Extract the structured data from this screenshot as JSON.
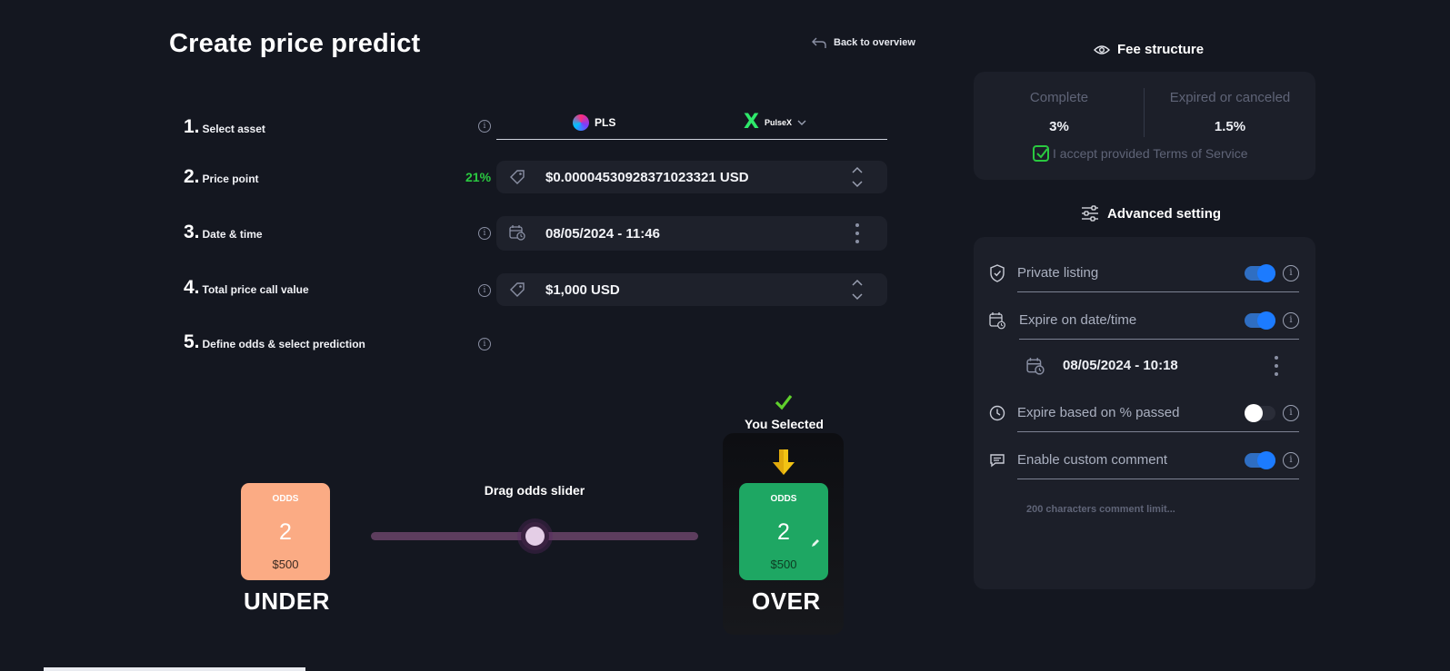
{
  "header": {
    "title": "Create price predict",
    "back_label": "Back to overview"
  },
  "steps": [
    {
      "num": "1.",
      "label": "Select asset"
    },
    {
      "num": "2.",
      "label": "Price point"
    },
    {
      "num": "3.",
      "label": "Date & time"
    },
    {
      "num": "4.",
      "label": "Total price call value"
    },
    {
      "num": "5.",
      "label": "Define odds & select prediction"
    }
  ],
  "asset": {
    "token": "PLS",
    "exchange": "PulseX"
  },
  "price_point": {
    "percent": "21%",
    "value": "$0.0000453092837102332​1 USD"
  },
  "date_time": {
    "value": "08/05/2024 - 11:46"
  },
  "total_value": {
    "value": "$1,000 USD"
  },
  "odds": {
    "slider_label": "Drag odds slider",
    "slider_position": 0.48,
    "you_selected": "You Selected",
    "under": {
      "label": "ODDS",
      "value": "2",
      "amount": "$500",
      "name": "UNDER"
    },
    "over": {
      "label": "ODDS",
      "value": "2",
      "amount": "$500",
      "name": "OVER"
    }
  },
  "fee": {
    "title": "Fee structure",
    "complete_label": "Complete",
    "complete_value": "3%",
    "expired_label": "Expired or canceled",
    "expired_value": "1.5%",
    "terms": "I accept provided Terms of Service",
    "terms_checked": true
  },
  "advanced": {
    "title": "Advanced setting",
    "private_listing": {
      "label": "Private listing",
      "on": true
    },
    "expire_date": {
      "label": "Expire on date/time",
      "on": true,
      "value": "08/05/2024 - 10:18"
    },
    "expire_percent": {
      "label": "Expire based on % passed",
      "on": false
    },
    "custom_comment": {
      "label": "Enable custom comment",
      "on": true,
      "placeholder": "200 characters comment limit..."
    }
  },
  "colors": {
    "background": "#141720",
    "panel": "#1c1f29",
    "under": "#fbab84",
    "over": "#1ea763",
    "accent_green": "#2ac940",
    "toggle_blue": "#1c7bff"
  }
}
